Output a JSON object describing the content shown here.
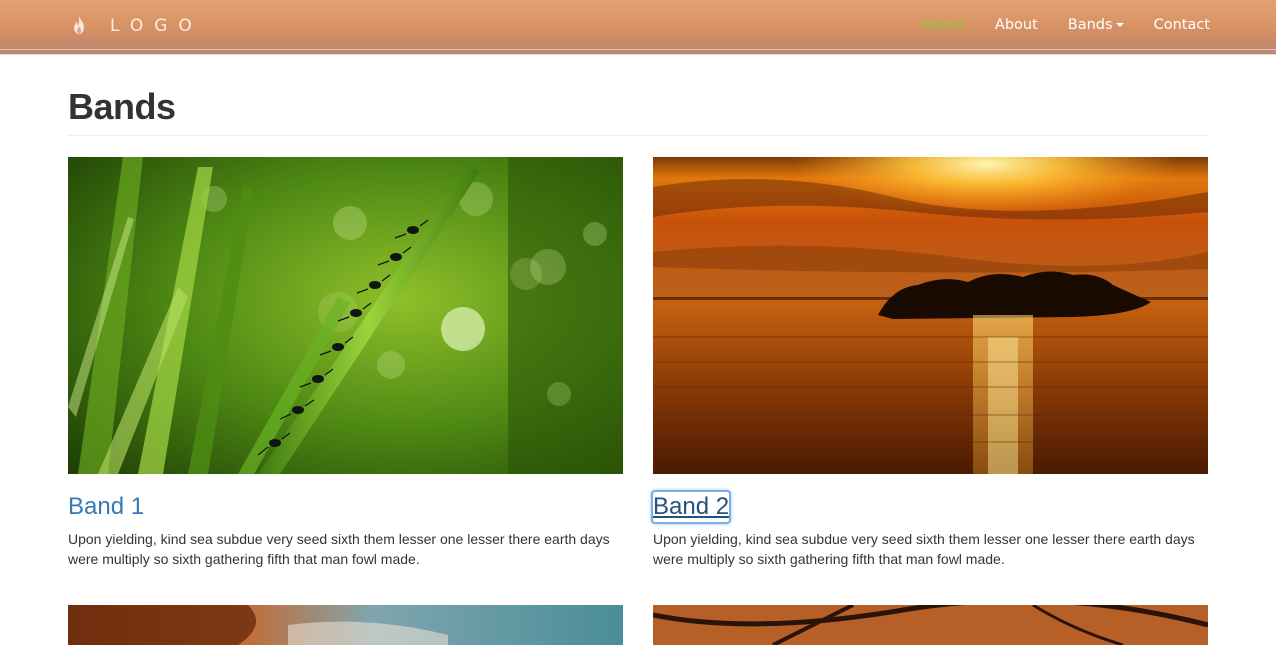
{
  "navbar": {
    "brand_icon": "flame-icon",
    "brand_text": "LOGO",
    "links": [
      {
        "label": "Home",
        "active": true
      },
      {
        "label": "About",
        "active": false
      },
      {
        "label": "Bands",
        "active": false,
        "dropdown": true
      },
      {
        "label": "Contact",
        "active": false
      }
    ],
    "active_color": "#8fc63a"
  },
  "page": {
    "title": "Bands"
  },
  "cards": [
    {
      "title": "Band 1",
      "text": "Upon yielding, kind sea subdue very seed sixth them lesser one lesser there earth days were multiply so sixth gathering fifth that man fowl made.",
      "image": "ants-on-grass-photo"
    },
    {
      "title": "Band 2",
      "text": "Upon yielding, kind sea subdue very seed sixth them lesser one lesser there earth days were multiply so sixth gathering fifth that man fowl made.",
      "image": "sunset-lake-island-photo",
      "focused": true
    }
  ],
  "next_row_images": [
    "rocky-coast-photo",
    "autumn-tree-photo"
  ],
  "colors": {
    "link": "#337ab7",
    "link_focused": "#23527c",
    "text": "#333333"
  }
}
